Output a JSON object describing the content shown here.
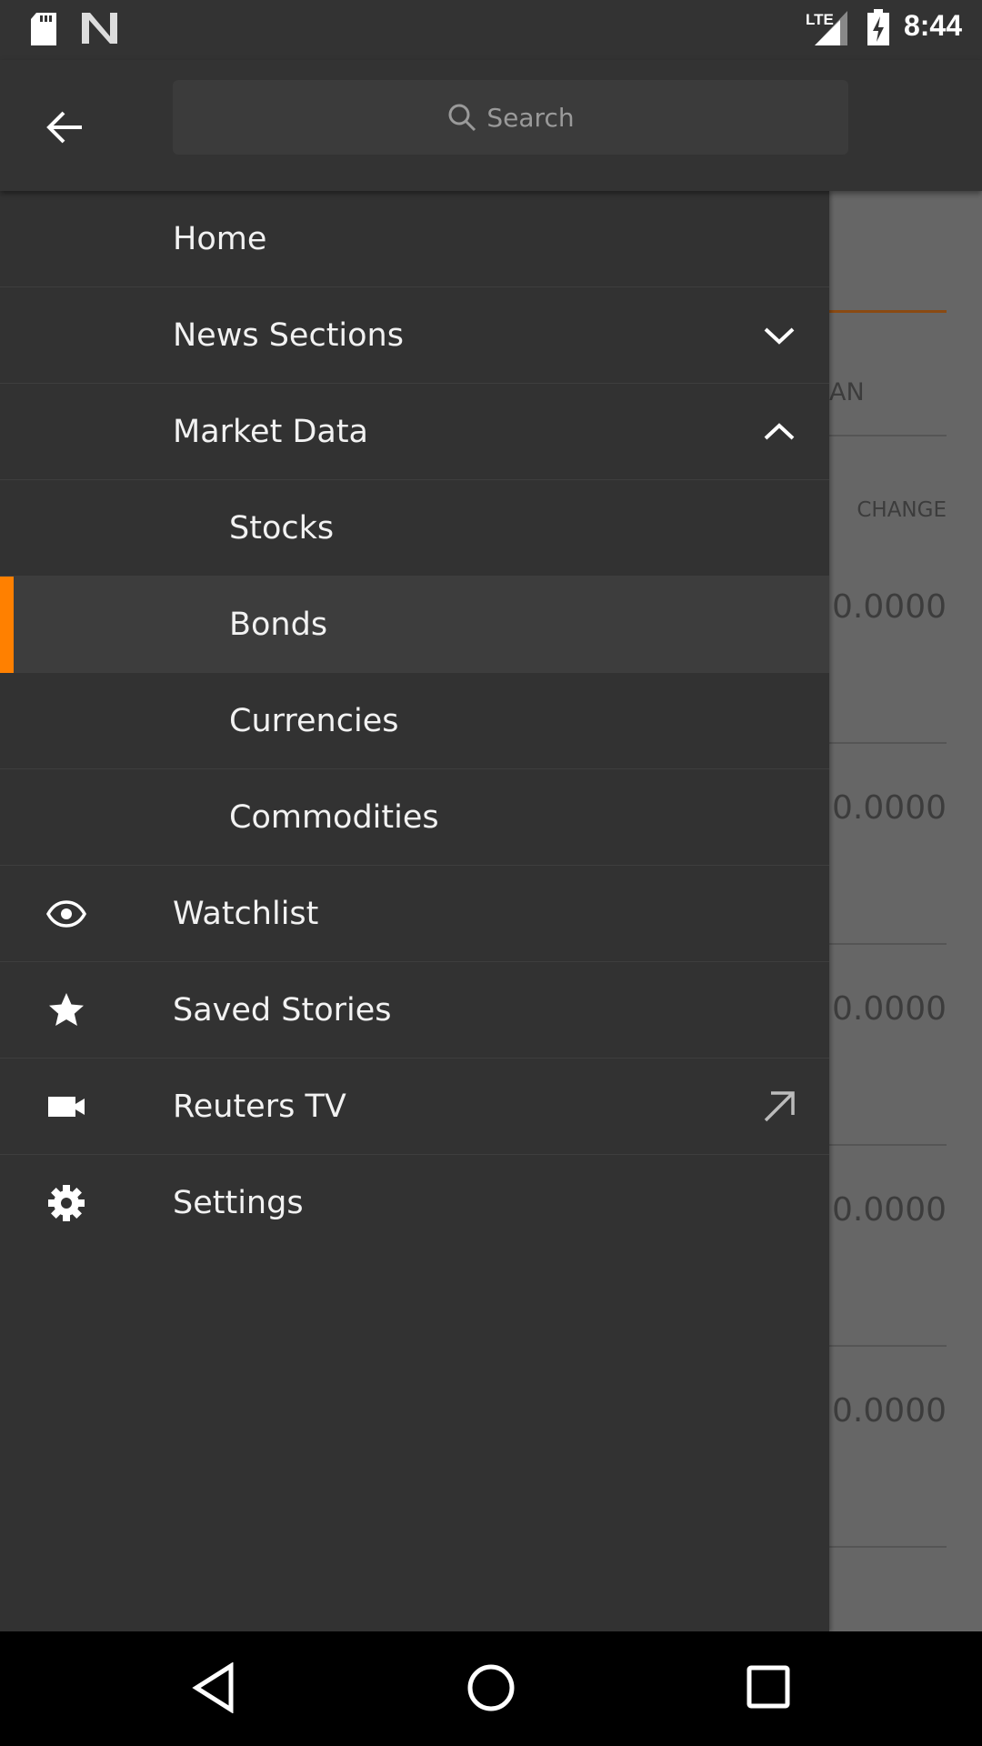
{
  "status_bar": {
    "time": "8:44",
    "network": "LTE",
    "icons": [
      "sd-card-icon",
      "n-icon",
      "signal-icon",
      "battery-charging-icon"
    ]
  },
  "app_bar": {
    "search_placeholder": "Search"
  },
  "drawer": {
    "items": [
      {
        "label": "Home",
        "icon": null
      },
      {
        "label": "News Sections",
        "trailing": "chevron-down-icon"
      },
      {
        "label": "Market Data",
        "trailing": "chevron-up-icon"
      },
      {
        "label": "Stocks",
        "sub": true
      },
      {
        "label": "Bonds",
        "sub": true,
        "active": true
      },
      {
        "label": "Currencies",
        "sub": true
      },
      {
        "label": "Commodities",
        "sub": true
      },
      {
        "label": "Watchlist",
        "icon": "eye-icon"
      },
      {
        "label": "Saved Stories",
        "icon": "star-icon"
      },
      {
        "label": "Reuters TV",
        "icon": "video-camera-icon",
        "trailing": "external-link-icon"
      },
      {
        "label": "Settings",
        "icon": "gear-icon"
      }
    ],
    "accent": "#ff8000"
  },
  "background": {
    "tab_partial": "AN",
    "column_header": "CHANGE",
    "values": [
      "0.0000",
      "0.0000",
      "0.0000",
      "0.0000",
      "0.0000"
    ]
  }
}
